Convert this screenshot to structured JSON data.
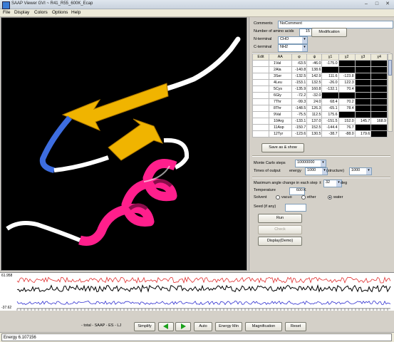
{
  "window": {
    "title": "SAAP Viewer GVI ~ R41_R55_600K_Ecap",
    "minimize": "–",
    "maximize": "□",
    "close": "✕",
    "app_icon": "app-icon"
  },
  "menu": [
    "File",
    "Display",
    "Colors",
    "Options",
    "Help"
  ],
  "panel": {
    "comments_label": "Comments",
    "comments_value": "NoComment",
    "num_aa_label": "Number of amino acids",
    "num_aa_value": "15",
    "modification_button": "Modification",
    "n_terminal_label": "N-terminal",
    "n_terminal_value": "CHO",
    "c_terminal_label": "C-terminal",
    "c_terminal_value": "NH2",
    "table": {
      "headers": [
        "Edit",
        "AA",
        "φ",
        "ψ",
        "χ1",
        "χ2",
        "χ3",
        "χ4"
      ],
      "rows": [
        [
          "1",
          "Val",
          "-63.5",
          "-46.0",
          "-175.0",
          "",
          "",
          ""
        ],
        [
          "2",
          "Ala",
          "-140.8",
          "138.6",
          "",
          "",
          "",
          ""
        ],
        [
          "3",
          "Ser",
          "-132.5",
          "142.9",
          "111.6",
          "-123.8",
          "",
          ""
        ],
        [
          "4",
          "Leu",
          "-153.1",
          "132.5",
          "-26.0",
          "122.3",
          "",
          ""
        ],
        [
          "5",
          "Cys",
          "-135.9",
          "160.8",
          "-132.1",
          "70.4",
          "",
          ""
        ],
        [
          "6",
          "Gly",
          "-72.2",
          "-32.0",
          "",
          "",
          "",
          ""
        ],
        [
          "7",
          "Thr",
          "-99.3",
          "24.0",
          "68.4",
          "70.2",
          "",
          ""
        ],
        [
          "8",
          "Thr",
          "-148.5",
          "126.3",
          "-65.1",
          "78.4",
          "",
          ""
        ],
        [
          "9",
          "Val",
          "-75.5",
          "112.5",
          "175.6",
          "",
          "",
          ""
        ],
        [
          "10",
          "Arg",
          "-133.1",
          "137.0",
          "-151.5",
          "152.0",
          "145.7",
          "168.9"
        ],
        [
          "11",
          "Asp",
          "-150.7",
          "152.5",
          "-144.4",
          "76.7",
          "",
          ""
        ],
        [
          "12",
          "Tyr",
          "-123.6",
          "130.5",
          "-38.7",
          "-88.0",
          "179.6",
          ""
        ]
      ]
    },
    "save_button": "Save as & show",
    "mc_steps_label": "Monte Carlo steps",
    "mc_steps_value": "10000000",
    "times_output_label": "Times of output",
    "energy_label": "energy",
    "energy_value": "1000",
    "structure_label": "(structure)",
    "structure_value": "1000",
    "max_angle_label": "Maximum angle change in each step",
    "max_angle_pm": "±",
    "max_angle_value": "32",
    "deg_label": "deg",
    "temperature_label": "Temperature",
    "temperature_value": "600",
    "temperature_unit": "K",
    "solvent_label": "Solvent",
    "solvent_options": [
      "vacuo",
      "ether",
      "water"
    ],
    "seed_label": "Seed (if any)",
    "seed_value": "",
    "run_button": "Run",
    "check_button": "Check",
    "display_demo_button": "Display(Demo)"
  },
  "energy_chart": {
    "y_max_label": "61.958",
    "y_min_label": "-37.62",
    "legend": "- total - SAAP - ES - LJ",
    "colors": {
      "total": "#000000",
      "saap": "#e03030",
      "es": "#3030d0",
      "lj": "#000000"
    }
  },
  "bottom": {
    "simplify_button": "Simplify",
    "prev_icon": "play-left-icon",
    "next_icon": "play-right-icon",
    "auto_button": "Auto",
    "energy_min_button": "Energy Min",
    "magnification_button": "Magnification",
    "reset_button": "Reset"
  },
  "status": {
    "text": "Energy 6.107156"
  },
  "colors": {
    "strand": "#f0b400",
    "helix": "#ff1f8c",
    "coil": "#ffffff",
    "turn": "#3d6de0",
    "viewport_bg": "#000000"
  }
}
